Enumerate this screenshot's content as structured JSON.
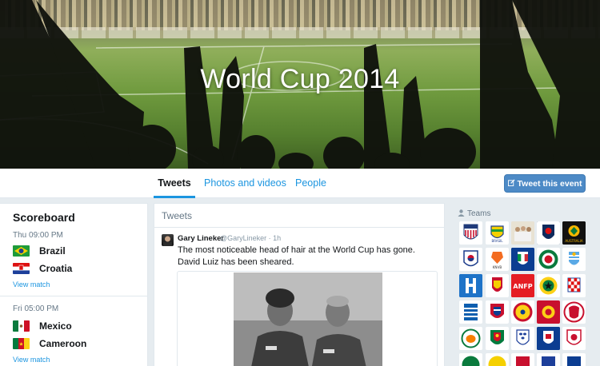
{
  "hero": {
    "title": "World Cup 2014"
  },
  "nav": {
    "tabs": [
      {
        "label": "Tweets",
        "active": true
      },
      {
        "label": "Photos and videos",
        "active": false
      },
      {
        "label": "People",
        "active": false
      }
    ],
    "tweet_button": "Tweet this event",
    "tweet_button_icon": "compose-icon"
  },
  "scoreboard": {
    "title": "Scoreboard",
    "matches": [
      {
        "time": "Thu 09:00 PM",
        "home": "Brazil",
        "away": "Croatia",
        "link": "View match"
      },
      {
        "time": "Fri 05:00 PM",
        "home": "Mexico",
        "away": "Cameroon",
        "link": "View match"
      }
    ]
  },
  "tweets": {
    "header": "Tweets",
    "items": [
      {
        "name": "Gary Lineker",
        "handle": "@GaryLineker · 1h",
        "text": "The most noticeable head of hair at the World Cup has gone. David Luiz has been sheared."
      }
    ]
  },
  "teams": {
    "label": "Teams",
    "label_icon": "person-icon",
    "badges": [
      "usa-crest",
      "brazil-crest",
      "germany-team-photo",
      "japan-crest",
      "australia-crest",
      "korea-crest",
      "netherlands-crest",
      "italy-crest",
      "mexico-crest",
      "uruguay-crest",
      "honduras-crest",
      "belgium-crest",
      "ecuador-crest",
      "ghana-crest",
      "croatia-crest",
      "greece-crest",
      "costa-rica-crest",
      "colombia-crest",
      "spain-crest",
      "switzerland-crest",
      "ivory-coast-crest",
      "cameroon-crest",
      "england-crest",
      "france-crest",
      "russia-crest"
    ]
  }
}
